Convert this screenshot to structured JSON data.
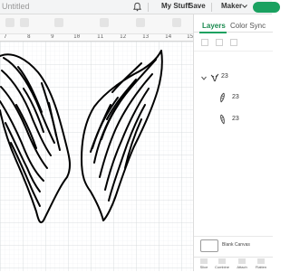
{
  "header": {
    "title": "Untitled",
    "my_stuff_label": "My Stuff",
    "save_label": "Save",
    "machine_label": "Maker"
  },
  "ruler": {
    "ticks": [
      "7",
      "8",
      "9",
      "10",
      "11",
      "12",
      "13",
      "14",
      "15"
    ]
  },
  "panel": {
    "tabs": [
      "Layers",
      "Color Sync"
    ],
    "layers": {
      "group": {
        "label": "23"
      },
      "children": [
        {
          "label": "23"
        },
        {
          "label": "23"
        }
      ]
    },
    "blank_canvas_label": "Blank Canvas",
    "bottom_tools": [
      "Slice",
      "Combine",
      "Attach",
      "Flatten"
    ]
  },
  "colors": {
    "accent": "#1aa160",
    "grid_minor": "#eceff1",
    "grid_major": "#d2d6d9",
    "wing_stroke": "#000000"
  },
  "icons": {
    "bell": "bell-icon",
    "chevron": "chevron-down-icon",
    "wing": "wing-thumbnail-icon"
  }
}
